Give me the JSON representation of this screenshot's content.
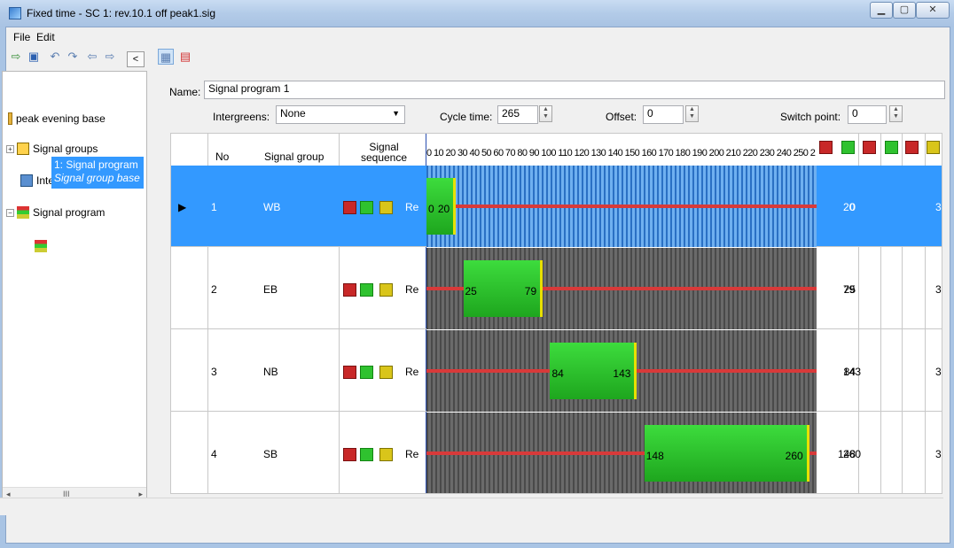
{
  "window": {
    "title": "Fixed time - SC 1: rev.10.1 off peak1.sig"
  },
  "menu": {
    "file": "File",
    "edit": "Edit"
  },
  "collapse_label": "<",
  "tree": {
    "root": "peak evening base",
    "signal_groups": "Signal groups",
    "intergreen": "Intergreen matr  e",
    "signal_program": "Signal program",
    "selected_line1": "1: Signal program",
    "selected_line2": "Signal group base",
    "scroll_label": "III"
  },
  "form": {
    "name_label": "Name:",
    "name_value": "Signal program 1",
    "intergreens_label": "Intergreens:",
    "intergreens_value": "None",
    "cycle_label": "Cycle time:",
    "cycle_value": "265",
    "offset_label": "Offset:",
    "offset_value": "0",
    "switch_label": "Switch point:",
    "switch_value": "0"
  },
  "table": {
    "headers": {
      "no": "No",
      "group": "Signal group",
      "sequence_1": "Signal",
      "sequence_2": "sequence"
    },
    "ruler": "0  10 20 30 40 50 60 70 80 90 100 110 120 130 140 150 160 170 180 190 200 210 220 230 240 250 2",
    "cycle": 265,
    "rows": [
      {
        "no": "1",
        "group": "WB",
        "seq": "Re",
        "start": 0,
        "end": 20,
        "start_label": "0",
        "end_label": "20",
        "col_start": "0",
        "col_end": "20",
        "last": "3"
      },
      {
        "no": "2",
        "group": "EB",
        "seq": "Re",
        "start": 25,
        "end": 79,
        "start_label": "25",
        "end_label": "79",
        "col_start": "25",
        "col_end": "79",
        "last": "3"
      },
      {
        "no": "3",
        "group": "NB",
        "seq": "Re",
        "start": 84,
        "end": 143,
        "start_label": "84",
        "end_label": "143",
        "col_start": "84",
        "col_end": "143",
        "last": "3"
      },
      {
        "no": "4",
        "group": "SB",
        "seq": "Re",
        "start": 148,
        "end": 260,
        "start_label": "148",
        "end_label": "260",
        "col_start": "148",
        "col_end": "260",
        "last": "3"
      }
    ]
  },
  "colors": {
    "selected": "#3399ff",
    "green": "#2fc22f",
    "red": "#d83a3a",
    "amber": "#e8e000"
  }
}
